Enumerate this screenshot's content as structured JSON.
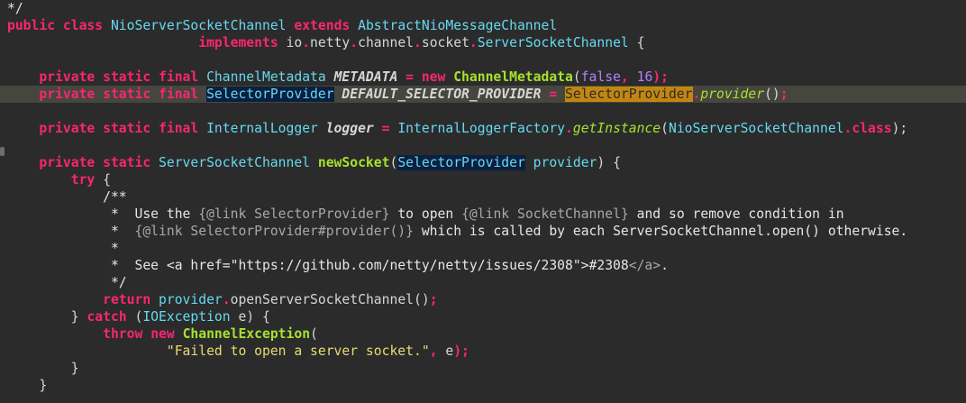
{
  "colors": {
    "background": "#2b2b2b",
    "current_line": "#46463f",
    "keyword": "#f92672",
    "type": "#66d9ef",
    "identifier": "#a6e22e",
    "italic_type": "#a6e22e",
    "string": "#e6db74",
    "number": "#ae81ff",
    "comment": "#e6e6e6",
    "plain": "#d6d6d6",
    "selection": "#0b1f40",
    "occurrence": "#c28610"
  },
  "editor": {
    "lines": [
      [
        {
          "text": "*/",
          "role": "comment"
        }
      ],
      [
        {
          "text": "public class ",
          "role": "keyword"
        },
        {
          "text": "NioServerSocketChannel ",
          "role": "type"
        },
        {
          "text": "extends ",
          "role": "keyword"
        },
        {
          "text": "AbstractNioMessageChannel",
          "role": "type"
        }
      ],
      [
        {
          "text": "                        "
        },
        {
          "text": "implements ",
          "role": "keyword"
        },
        {
          "text": "io",
          "role": "plain"
        },
        {
          "text": ".",
          "role": "keyword"
        },
        {
          "text": "netty",
          "role": "plain"
        },
        {
          "text": ".",
          "role": "keyword"
        },
        {
          "text": "channel",
          "role": "plain"
        },
        {
          "text": ".",
          "role": "keyword"
        },
        {
          "text": "socket",
          "role": "plain"
        },
        {
          "text": ".",
          "role": "keyword"
        },
        {
          "text": "ServerSocketChannel",
          "role": "type"
        },
        {
          "text": " {",
          "role": "plain"
        }
      ],
      [],
      [
        {
          "text": "    "
        },
        {
          "text": "private static final ",
          "role": "keyword"
        },
        {
          "text": "ChannelMetadata ",
          "role": "type"
        },
        {
          "text": "METADATA",
          "role": "const"
        },
        {
          "text": " = ",
          "role": "keyword"
        },
        {
          "text": "new ",
          "role": "keyword"
        },
        {
          "text": "ChannelMetadata",
          "role": "identifier"
        },
        {
          "text": "(",
          "role": "plain"
        },
        {
          "text": "false",
          "role": "number"
        },
        {
          "text": ", ",
          "role": "keyword"
        },
        {
          "text": "16",
          "role": "number"
        },
        {
          "text": ");",
          "role": "keyword"
        }
      ],
      [
        {
          "text": "    "
        },
        {
          "text": "private static final ",
          "role": "keyword"
        },
        {
          "text": "SelectorProvider",
          "role": "type",
          "hl": "sel"
        },
        {
          "text": " ",
          "role": "plain"
        },
        {
          "text": "DEFAULT_SELECTOR_PROVIDER",
          "role": "const"
        },
        {
          "text": " = ",
          "role": "keyword"
        },
        {
          "text": "SelectorProvider",
          "role": "type",
          "hl": "occ"
        },
        {
          "text": ".",
          "role": "keyword"
        },
        {
          "text": "provider",
          "role": "italic"
        },
        {
          "text": "()",
          "role": "plain"
        },
        {
          "text": ";",
          "role": "keyword"
        }
      ],
      [],
      [
        {
          "text": "    "
        },
        {
          "text": "private static final ",
          "role": "keyword"
        },
        {
          "text": "InternalLogger ",
          "role": "type"
        },
        {
          "text": "logger",
          "role": "const2"
        },
        {
          "text": " = ",
          "role": "keyword"
        },
        {
          "text": "InternalLoggerFactory",
          "role": "type"
        },
        {
          "text": ".",
          "role": "keyword"
        },
        {
          "text": "getInstance",
          "role": "italic"
        },
        {
          "text": "(",
          "role": "plain"
        },
        {
          "text": "NioServerSocketChannel",
          "role": "type"
        },
        {
          "text": ".",
          "role": "keyword"
        },
        {
          "text": "class",
          "role": "keyword"
        },
        {
          "text": ");",
          "role": "plain"
        }
      ],
      [],
      [
        {
          "text": "    "
        },
        {
          "text": "private static ",
          "role": "keyword"
        },
        {
          "text": "ServerSocketChannel ",
          "role": "type"
        },
        {
          "text": "newSocket",
          "role": "identifier"
        },
        {
          "text": "(",
          "role": "plain"
        },
        {
          "text": "SelectorProvider",
          "role": "type",
          "hl": "sel"
        },
        {
          "text": " ",
          "role": "plain"
        },
        {
          "text": "provider",
          "role": "type"
        },
        {
          "text": ") {",
          "role": "plain"
        }
      ],
      [
        {
          "text": "        "
        },
        {
          "text": "try",
          "role": "keyword"
        },
        {
          "text": " {",
          "role": "plain"
        }
      ],
      [
        {
          "text": "            "
        },
        {
          "text": "/**",
          "role": "comment"
        }
      ],
      [
        {
          "text": "             "
        },
        {
          "text": "*  Use the ",
          "role": "comment"
        },
        {
          "text": "{@link SelectorProvider}",
          "role": "doc"
        },
        {
          "text": " to open ",
          "role": "comment"
        },
        {
          "text": "{@link SocketChannel}",
          "role": "doc"
        },
        {
          "text": " and so remove condition in",
          "role": "comment"
        }
      ],
      [
        {
          "text": "             "
        },
        {
          "text": "*  ",
          "role": "comment"
        },
        {
          "text": "{@link SelectorProvider#provider()}",
          "role": "doc"
        },
        {
          "text": " which is called by each ServerSocketChannel.open() otherwise.",
          "role": "comment"
        }
      ],
      [
        {
          "text": "             "
        },
        {
          "text": "*",
          "role": "comment"
        }
      ],
      [
        {
          "text": "             "
        },
        {
          "text": "*  See <a href=\"https://github.com/netty/netty/issues/2308\">#2308",
          "role": "comment"
        },
        {
          "text": "</a>",
          "role": "doc"
        },
        {
          "text": ".",
          "role": "comment"
        }
      ],
      [
        {
          "text": "             "
        },
        {
          "text": "*/",
          "role": "comment"
        }
      ],
      [
        {
          "text": "            "
        },
        {
          "text": "return ",
          "role": "keyword"
        },
        {
          "text": "provider",
          "role": "type"
        },
        {
          "text": ".",
          "role": "keyword"
        },
        {
          "text": "openServerSocketChannel",
          "role": "plain"
        },
        {
          "text": "()",
          "role": "plain"
        },
        {
          "text": ";",
          "role": "keyword"
        }
      ],
      [
        {
          "text": "        "
        },
        {
          "text": "} ",
          "role": "plain"
        },
        {
          "text": "catch ",
          "role": "keyword"
        },
        {
          "text": "(",
          "role": "plain"
        },
        {
          "text": "IOException ",
          "role": "type"
        },
        {
          "text": "e) {",
          "role": "plain"
        }
      ],
      [
        {
          "text": "            "
        },
        {
          "text": "throw ",
          "role": "keyword"
        },
        {
          "text": "new ",
          "role": "keyword"
        },
        {
          "text": "ChannelException",
          "role": "identifier"
        },
        {
          "text": "(",
          "role": "plain"
        }
      ],
      [
        {
          "text": "                    "
        },
        {
          "text": "\"Failed to open a server socket.\"",
          "role": "string"
        },
        {
          "text": ", ",
          "role": "keyword"
        },
        {
          "text": "e",
          "role": "plain"
        },
        {
          "text": ");",
          "role": "keyword"
        }
      ],
      [
        {
          "text": "        "
        },
        {
          "text": "}",
          "role": "plain"
        }
      ],
      [
        {
          "text": "    "
        },
        {
          "text": "}",
          "role": "plain"
        }
      ]
    ],
    "current_line_index": 5
  }
}
